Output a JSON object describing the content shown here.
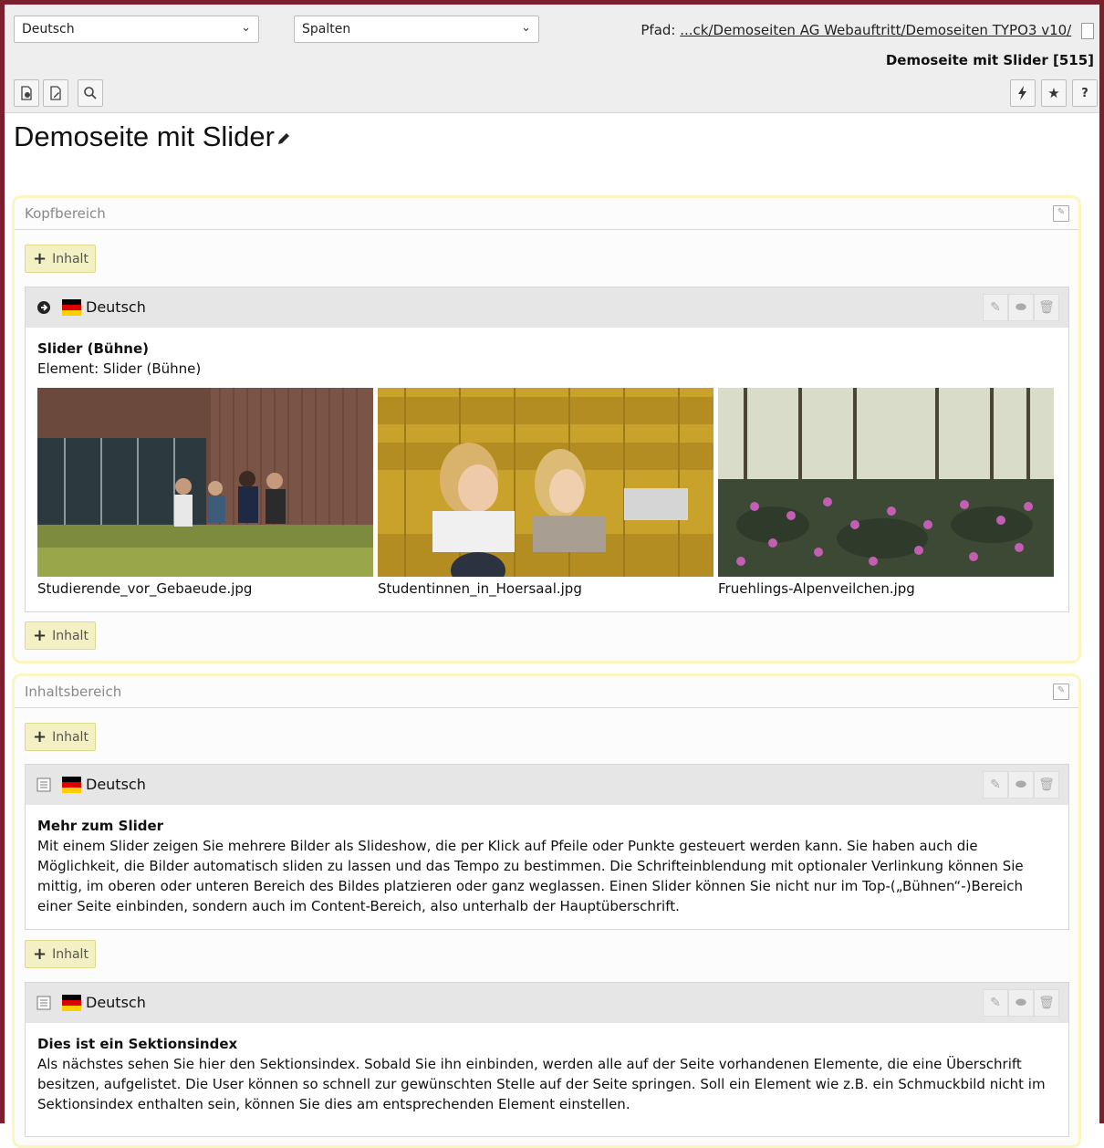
{
  "toolbar": {
    "language_select": "Deutsch",
    "view_select": "Spalten",
    "path_label": "Pfad:",
    "path_value": "...ck/Demoseiten AG Webauftritt/Demoseiten TYPO3 v10/",
    "page_ref": "Demoseite mit Slider [515]",
    "help_label": "?"
  },
  "page": {
    "title": "Demoseite mit Slider"
  },
  "add_label": "Inhalt",
  "sections": [
    {
      "name": "Kopfbereich",
      "element": {
        "language": "Deutsch",
        "heading": "Slider (Bühne)",
        "subtitle": "Element: Slider (Bühne)",
        "images": [
          {
            "caption": "Studierende_vor_Gebaeude.jpg"
          },
          {
            "caption": "Studentinnen_in_Hoersaal.jpg"
          },
          {
            "caption": "Fruehlings-Alpenveilchen.jpg"
          }
        ]
      }
    },
    {
      "name": "Inhaltsbereich",
      "elements": [
        {
          "language": "Deutsch",
          "heading": "Mehr zum Slider",
          "text": "Mit einem Slider zeigen Sie mehrere Bilder als Slideshow, die per Klick auf Pfeile oder Punkte gesteuert werden kann. Sie haben auch die Möglichkeit, die Bilder automatisch sliden zu lassen und das Tempo zu bestimmen. Die Schrifteinblendung mit optionaler Verlinkung können Sie mittig, im oberen oder unteren Bereich des Bildes platzieren oder ganz weglassen. Einen Slider können Sie nicht nur im Top-(„Bühnen“-)Bereich einer Seite einbinden, sondern auch im Content-Bereich, also unterhalb der Hauptüberschrift."
        },
        {
          "language": "Deutsch",
          "heading": "Dies ist ein Sektionsindex",
          "text": "Als nächstes sehen Sie hier den Sektionsindex. Sobald Sie ihn einbinden, werden alle auf der Seite vorhandenen Elemente, die eine Überschrift besitzen, aufgelistet. Die User können so schnell zur gewünschten Stelle auf der Seite springen. Soll ein Element wie z.B. ein Schmuckbild nicht im Sektionsindex enthalten sein, können Sie dies am entsprechenden Element einstellen."
        }
      ]
    }
  ]
}
